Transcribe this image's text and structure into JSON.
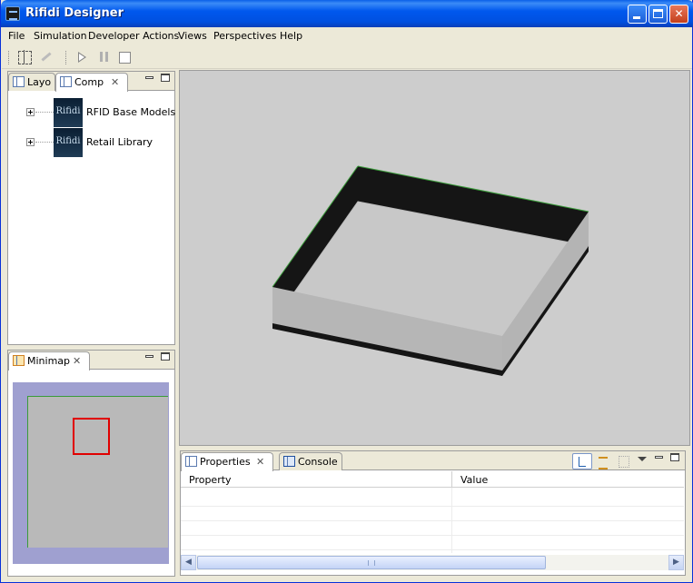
{
  "window": {
    "title": "Rifidi Designer",
    "controls": {
      "minimize": "",
      "maximize": "",
      "close": "✕"
    }
  },
  "menubar": {
    "items": [
      {
        "label": "File"
      },
      {
        "label": "Simulation"
      },
      {
        "label": "Developer Actions"
      },
      {
        "label": "Views"
      },
      {
        "label": "Perspectives"
      },
      {
        "label": "Help"
      }
    ]
  },
  "toolbar": {
    "icons": [
      "select-icon",
      "wand-icon",
      "play-icon",
      "pause-icon",
      "stop-icon"
    ]
  },
  "left_panel": {
    "tabs": [
      {
        "label": "Layo",
        "active": false
      },
      {
        "label": "Comp",
        "active": true,
        "close": "✕"
      }
    ],
    "tree": [
      {
        "label": "RFID Base Models",
        "logo": "Rifidi"
      },
      {
        "label": "Retail Library",
        "logo": "Rifidi"
      }
    ]
  },
  "minimap": {
    "tab": {
      "label": "Minimap",
      "close": "✕"
    },
    "colors": {
      "background": "#9fa0d0",
      "floor": "#b9b9b9",
      "viewport": "#e00000"
    }
  },
  "scene": {
    "colors": {
      "background": "#cdcdcd",
      "walls": "#151515",
      "floor": "#c8c8c8",
      "edge": "#3a9b3a"
    }
  },
  "bottom_panel": {
    "tabs": [
      {
        "label": "Properties",
        "active": true,
        "close": "✕"
      },
      {
        "label": "Console",
        "active": false
      }
    ],
    "columns": [
      {
        "label": "Property"
      },
      {
        "label": "Value"
      }
    ],
    "scrollbar": {
      "left": "◀",
      "right": "▶",
      "grip": "|||"
    }
  }
}
